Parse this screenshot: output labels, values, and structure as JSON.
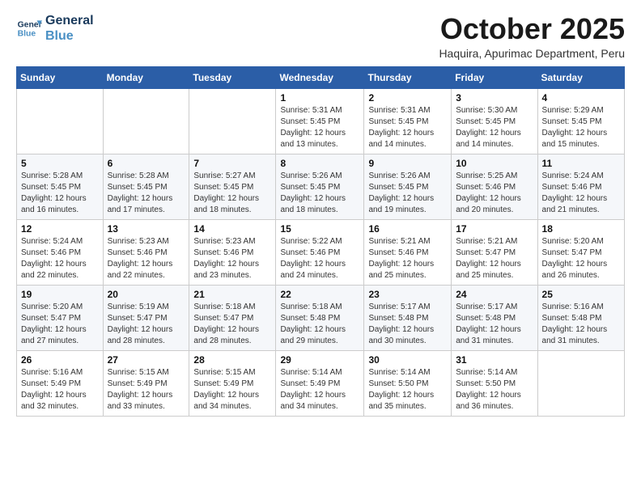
{
  "logo": {
    "line1": "General",
    "line2": "Blue"
  },
  "title": "October 2025",
  "subtitle": "Haquira, Apurimac Department, Peru",
  "weekdays": [
    "Sunday",
    "Monday",
    "Tuesday",
    "Wednesday",
    "Thursday",
    "Friday",
    "Saturday"
  ],
  "weeks": [
    [
      {
        "day": "",
        "info": ""
      },
      {
        "day": "",
        "info": ""
      },
      {
        "day": "",
        "info": ""
      },
      {
        "day": "1",
        "info": "Sunrise: 5:31 AM\nSunset: 5:45 PM\nDaylight: 12 hours\nand 13 minutes."
      },
      {
        "day": "2",
        "info": "Sunrise: 5:31 AM\nSunset: 5:45 PM\nDaylight: 12 hours\nand 14 minutes."
      },
      {
        "day": "3",
        "info": "Sunrise: 5:30 AM\nSunset: 5:45 PM\nDaylight: 12 hours\nand 14 minutes."
      },
      {
        "day": "4",
        "info": "Sunrise: 5:29 AM\nSunset: 5:45 PM\nDaylight: 12 hours\nand 15 minutes."
      }
    ],
    [
      {
        "day": "5",
        "info": "Sunrise: 5:28 AM\nSunset: 5:45 PM\nDaylight: 12 hours\nand 16 minutes."
      },
      {
        "day": "6",
        "info": "Sunrise: 5:28 AM\nSunset: 5:45 PM\nDaylight: 12 hours\nand 17 minutes."
      },
      {
        "day": "7",
        "info": "Sunrise: 5:27 AM\nSunset: 5:45 PM\nDaylight: 12 hours\nand 18 minutes."
      },
      {
        "day": "8",
        "info": "Sunrise: 5:26 AM\nSunset: 5:45 PM\nDaylight: 12 hours\nand 18 minutes."
      },
      {
        "day": "9",
        "info": "Sunrise: 5:26 AM\nSunset: 5:45 PM\nDaylight: 12 hours\nand 19 minutes."
      },
      {
        "day": "10",
        "info": "Sunrise: 5:25 AM\nSunset: 5:46 PM\nDaylight: 12 hours\nand 20 minutes."
      },
      {
        "day": "11",
        "info": "Sunrise: 5:24 AM\nSunset: 5:46 PM\nDaylight: 12 hours\nand 21 minutes."
      }
    ],
    [
      {
        "day": "12",
        "info": "Sunrise: 5:24 AM\nSunset: 5:46 PM\nDaylight: 12 hours\nand 22 minutes."
      },
      {
        "day": "13",
        "info": "Sunrise: 5:23 AM\nSunset: 5:46 PM\nDaylight: 12 hours\nand 22 minutes."
      },
      {
        "day": "14",
        "info": "Sunrise: 5:23 AM\nSunset: 5:46 PM\nDaylight: 12 hours\nand 23 minutes."
      },
      {
        "day": "15",
        "info": "Sunrise: 5:22 AM\nSunset: 5:46 PM\nDaylight: 12 hours\nand 24 minutes."
      },
      {
        "day": "16",
        "info": "Sunrise: 5:21 AM\nSunset: 5:46 PM\nDaylight: 12 hours\nand 25 minutes."
      },
      {
        "day": "17",
        "info": "Sunrise: 5:21 AM\nSunset: 5:47 PM\nDaylight: 12 hours\nand 25 minutes."
      },
      {
        "day": "18",
        "info": "Sunrise: 5:20 AM\nSunset: 5:47 PM\nDaylight: 12 hours\nand 26 minutes."
      }
    ],
    [
      {
        "day": "19",
        "info": "Sunrise: 5:20 AM\nSunset: 5:47 PM\nDaylight: 12 hours\nand 27 minutes."
      },
      {
        "day": "20",
        "info": "Sunrise: 5:19 AM\nSunset: 5:47 PM\nDaylight: 12 hours\nand 28 minutes."
      },
      {
        "day": "21",
        "info": "Sunrise: 5:18 AM\nSunset: 5:47 PM\nDaylight: 12 hours\nand 28 minutes."
      },
      {
        "day": "22",
        "info": "Sunrise: 5:18 AM\nSunset: 5:48 PM\nDaylight: 12 hours\nand 29 minutes."
      },
      {
        "day": "23",
        "info": "Sunrise: 5:17 AM\nSunset: 5:48 PM\nDaylight: 12 hours\nand 30 minutes."
      },
      {
        "day": "24",
        "info": "Sunrise: 5:17 AM\nSunset: 5:48 PM\nDaylight: 12 hours\nand 31 minutes."
      },
      {
        "day": "25",
        "info": "Sunrise: 5:16 AM\nSunset: 5:48 PM\nDaylight: 12 hours\nand 31 minutes."
      }
    ],
    [
      {
        "day": "26",
        "info": "Sunrise: 5:16 AM\nSunset: 5:49 PM\nDaylight: 12 hours\nand 32 minutes."
      },
      {
        "day": "27",
        "info": "Sunrise: 5:15 AM\nSunset: 5:49 PM\nDaylight: 12 hours\nand 33 minutes."
      },
      {
        "day": "28",
        "info": "Sunrise: 5:15 AM\nSunset: 5:49 PM\nDaylight: 12 hours\nand 34 minutes."
      },
      {
        "day": "29",
        "info": "Sunrise: 5:14 AM\nSunset: 5:49 PM\nDaylight: 12 hours\nand 34 minutes."
      },
      {
        "day": "30",
        "info": "Sunrise: 5:14 AM\nSunset: 5:50 PM\nDaylight: 12 hours\nand 35 minutes."
      },
      {
        "day": "31",
        "info": "Sunrise: 5:14 AM\nSunset: 5:50 PM\nDaylight: 12 hours\nand 36 minutes."
      },
      {
        "day": "",
        "info": ""
      }
    ]
  ]
}
